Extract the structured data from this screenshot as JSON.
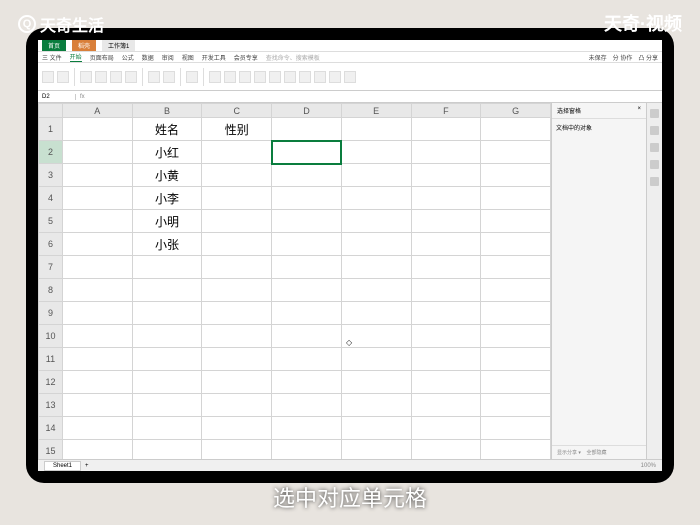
{
  "watermarks": {
    "topLeft": "天奇生活",
    "topRight": "天奇·视频"
  },
  "caption": "选中对应单元格",
  "titlebar": {
    "home": "首页",
    "second": "稻壳",
    "doc": "工作簿1"
  },
  "menu": {
    "file": "三 文件",
    "items": [
      "开始",
      "页面布局",
      "公式",
      "数据",
      "审阅",
      "视图",
      "开发工具",
      "会员专享"
    ],
    "search": "查找命令、搜索模板",
    "right": [
      "未保存",
      "分 协作",
      "凸 分享"
    ]
  },
  "namebox": {
    "cell": "D2",
    "fx": "fx"
  },
  "columns": [
    "A",
    "B",
    "C",
    "D",
    "E",
    "F",
    "G"
  ],
  "rows": [
    "1",
    "2",
    "3",
    "4",
    "5",
    "6",
    "7",
    "8",
    "9",
    "10",
    "11",
    "12",
    "13",
    "14",
    "15"
  ],
  "cells": {
    "B1": "姓名",
    "C1": "性别",
    "B2": "小红",
    "B3": "小黄",
    "B4": "小李",
    "B5": "小明",
    "B6": "小张"
  },
  "selectedCell": "D2",
  "side": {
    "title": "选择窗格",
    "sub": "文档中的对象",
    "foot1": "显示分享 ▾",
    "foot2": "全部隐藏"
  },
  "status": {
    "sheet": "Sheet1",
    "zoom": "100%"
  }
}
